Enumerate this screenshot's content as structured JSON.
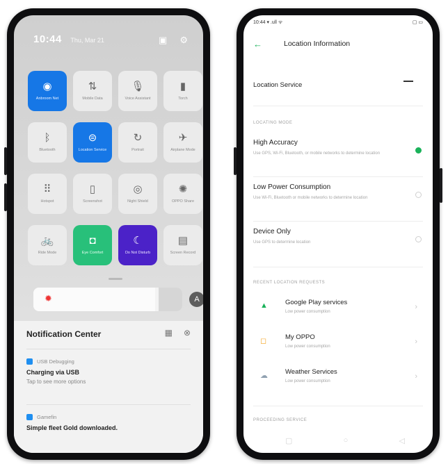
{
  "left_phone": {
    "status": {
      "time": "10:44",
      "date": "Thu, Mar 21",
      "subtitle": "",
      "icons": [
        "screen-mirror-icon",
        "gear-icon"
      ]
    },
    "tiles": [
      {
        "icon": "wifi-icon",
        "glyph": "◉",
        "label": "Anbroom Net",
        "state": "active-blue"
      },
      {
        "icon": "data-icon",
        "glyph": "⇅",
        "label": "Mobile Data",
        "state": "off"
      },
      {
        "icon": "microphone-icon",
        "glyph": "🎙",
        "label": "Voice Assistant",
        "state": "off"
      },
      {
        "icon": "torch-icon",
        "glyph": "▮",
        "label": "Torch",
        "state": "off"
      },
      {
        "icon": "bluetooth-icon",
        "glyph": "ᛒ",
        "label": "Bluetooth",
        "state": "off"
      },
      {
        "icon": "location-icon",
        "glyph": "⊜",
        "label": "Location Service",
        "state": "active-blue"
      },
      {
        "icon": "lock-rotation-icon",
        "glyph": "↻",
        "label": "Portrait",
        "state": "off"
      },
      {
        "icon": "airplane-icon",
        "glyph": "✈",
        "label": "Airplane Mode",
        "state": "off"
      },
      {
        "icon": "hotspot-icon",
        "glyph": "⠿",
        "label": "Hotspot",
        "state": "off"
      },
      {
        "icon": "screenshot-icon",
        "glyph": "▯",
        "label": "Screenshot",
        "state": "off"
      },
      {
        "icon": "night-shield-icon",
        "glyph": "◎",
        "label": "Night Shield",
        "state": "off"
      },
      {
        "icon": "nfc-icon",
        "glyph": "✺",
        "label": "OPPO Share",
        "state": "off"
      },
      {
        "icon": "bike-icon",
        "glyph": "🚲",
        "label": "Ride Mode",
        "state": "off"
      },
      {
        "icon": "game-icon",
        "glyph": "◘",
        "label": "Eye Comfort",
        "state": "active-green"
      },
      {
        "icon": "moon-icon",
        "glyph": "☾",
        "label": "Do Not Disturb",
        "state": "active-purple"
      },
      {
        "icon": "screen-record-icon",
        "glyph": "▤",
        "label": "Screen Record",
        "state": "off"
      }
    ],
    "brightness": {
      "level": 0.82,
      "auto_label": "A"
    },
    "notification_center": {
      "title": "Notification Center",
      "notifications": [
        {
          "app": "USB Debugging",
          "title": "Charging via USB",
          "detail": "Tap to see more options"
        },
        {
          "app": "Gamefin",
          "title": "Simple fleet Gold downloaded.",
          "detail": ""
        }
      ]
    }
  },
  "right_phone": {
    "status": {
      "left": "10:44 ▾ .ull ᯤ",
      "right": "▢ ▭"
    },
    "title": "Location Information",
    "location_service_label": "Location Service",
    "section_mode": "LOCATING MODE",
    "modes": [
      {
        "title": "High Accuracy",
        "detail": "Use GPS, Wi-Fi, Bluetooth, or mobile networks to determine location",
        "selected": true
      },
      {
        "title": "Low Power Consumption",
        "detail": "Use Wi-Fi, Bluetooth or mobile networks to determine location",
        "selected": false
      },
      {
        "title": "Device Only",
        "detail": "Use GPS to determine location",
        "selected": false
      }
    ],
    "section_recent": "RECENT LOCATION REQUESTS",
    "services": [
      {
        "icon": "google-play-icon",
        "glyph": "▲",
        "color": "#1ab25a",
        "title": "Google Play services",
        "detail": "Low power consumption"
      },
      {
        "icon": "my-oppo-icon",
        "glyph": "◻",
        "color": "#f5a623",
        "title": "My OPPO",
        "detail": "Low power consumption"
      },
      {
        "icon": "weather-icon",
        "glyph": "☁",
        "color": "#8fa0b0",
        "title": "Weather Services",
        "detail": "Low power consumption"
      }
    ],
    "section_more": "PROCEEDING SERVICE",
    "nav": [
      "▢",
      "○",
      "◁"
    ]
  },
  "colors": {
    "accent_blue": "#1677e6",
    "accent_green": "#28c07a",
    "accent_purple": "#4b22c8",
    "oppo_green": "#1ab25a"
  }
}
